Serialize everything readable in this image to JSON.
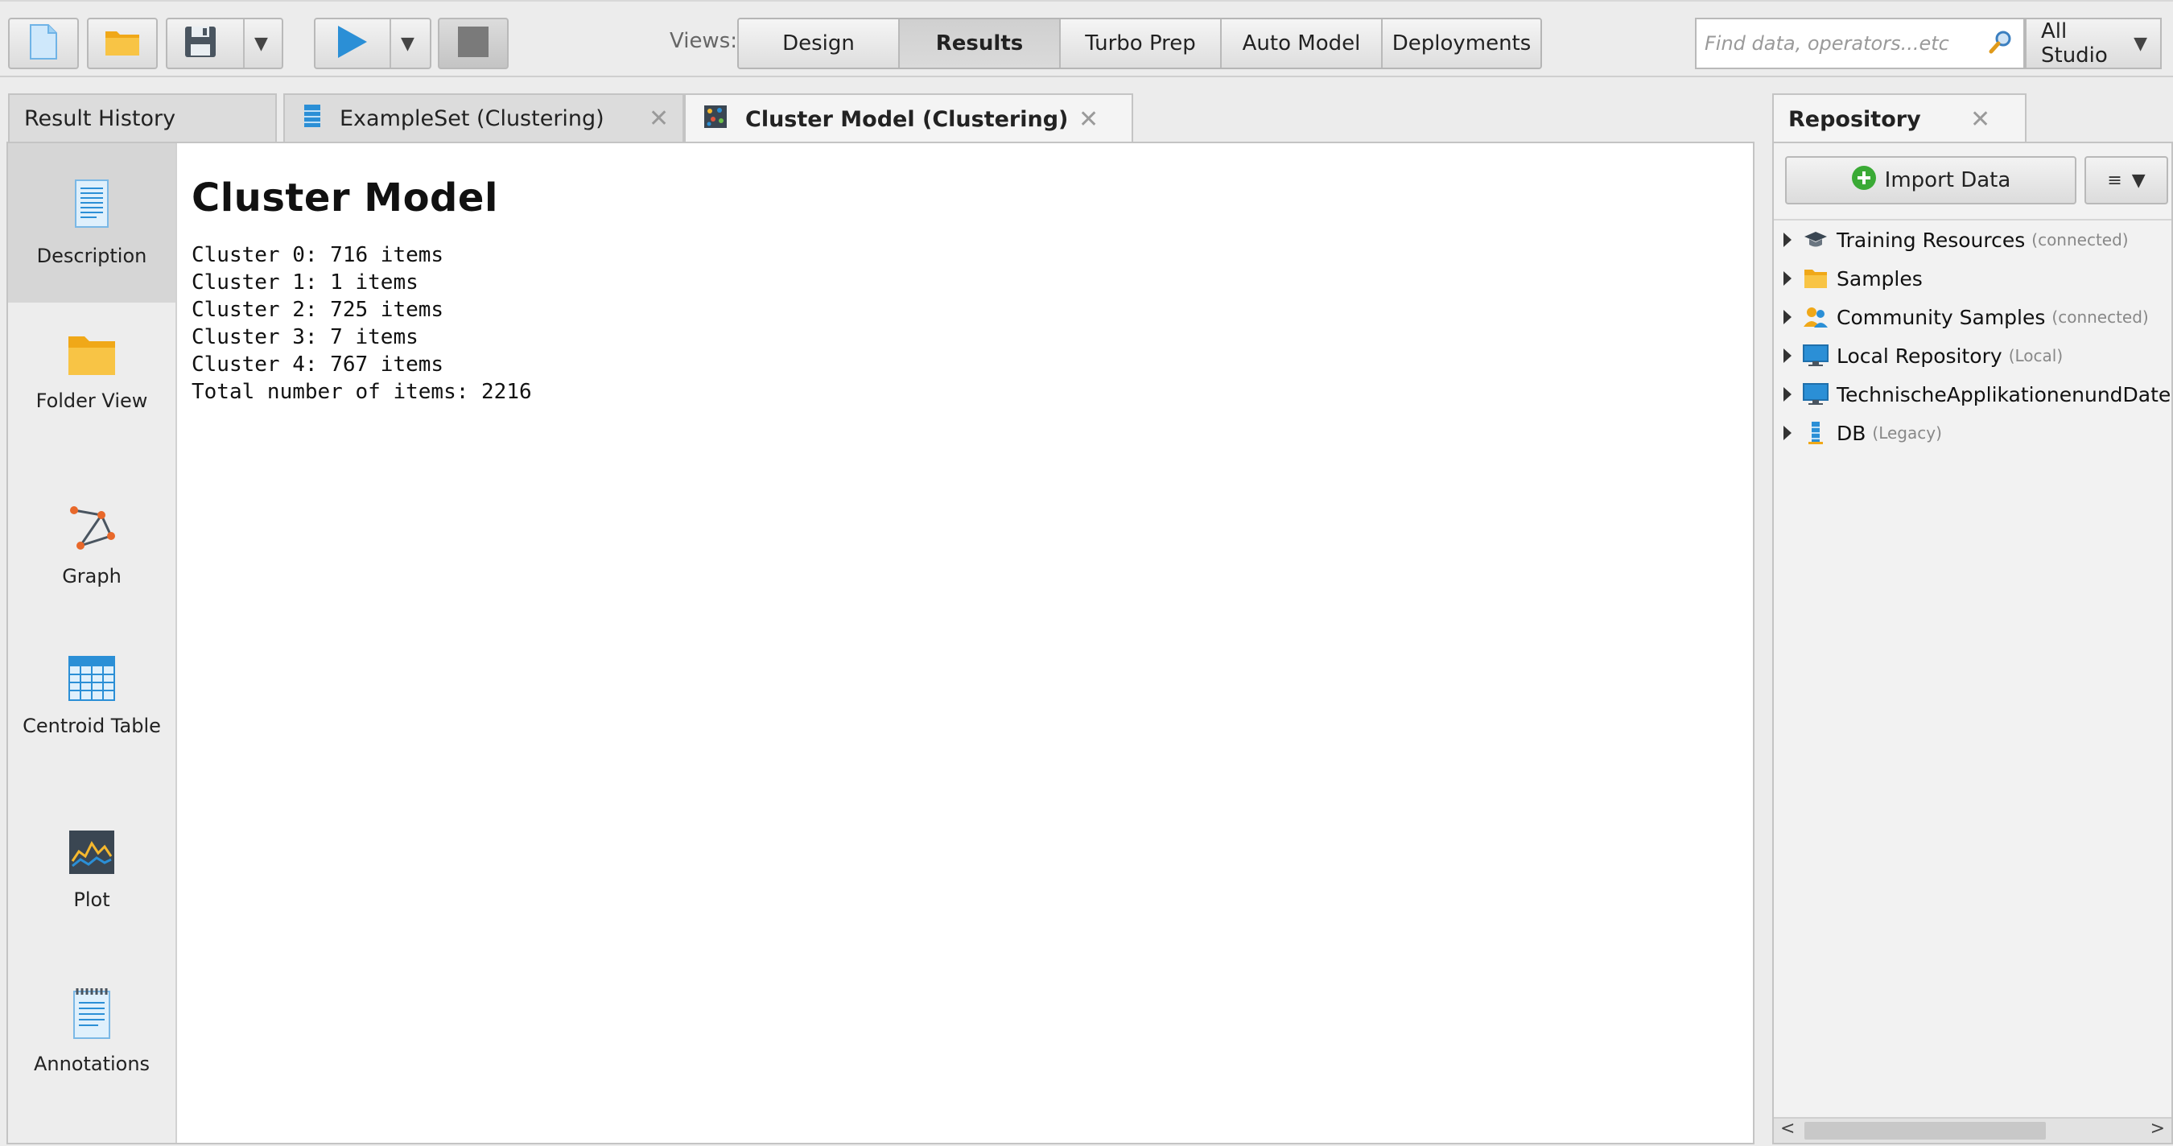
{
  "toolbar": {
    "new_icon": "new-process-icon",
    "open_icon": "folder-icon",
    "save_icon": "save-icon",
    "run_icon": "play-icon",
    "stop_icon": "stop-icon"
  },
  "views": {
    "label": "Views:",
    "items": [
      "Design",
      "Results",
      "Turbo Prep",
      "Auto Model",
      "Deployments"
    ],
    "active": "Results"
  },
  "search": {
    "placeholder": "Find data, operators...etc",
    "scope": "All Studio"
  },
  "tabs": [
    {
      "label": "Result History"
    },
    {
      "label": "ExampleSet (Clustering)"
    },
    {
      "label": "Cluster Model (Clustering)",
      "active": true
    }
  ],
  "sidebar": {
    "items": [
      {
        "label": "Description",
        "active": true
      },
      {
        "label": "Folder View"
      },
      {
        "label": "Graph"
      },
      {
        "label": "Centroid Table"
      },
      {
        "label": "Plot"
      },
      {
        "label": "Annotations"
      }
    ]
  },
  "model": {
    "title": "Cluster Model",
    "lines": [
      "Cluster 0: 716 items",
      "Cluster 1: 1 items",
      "Cluster 2: 725 items",
      "Cluster 3: 7 items",
      "Cluster 4: 767 items",
      "Total number of items: 2216"
    ]
  },
  "repository": {
    "title": "Repository",
    "import_label": "Import Data",
    "menu_label": "≡",
    "items": [
      {
        "label": "Training Resources",
        "note": "(connected)"
      },
      {
        "label": "Samples",
        "note": ""
      },
      {
        "label": "Community Samples",
        "note": "(connected)"
      },
      {
        "label": "Local Repository",
        "note": "(Local)"
      },
      {
        "label": "TechnischeApplikationenundDatenma",
        "note": ""
      },
      {
        "label": "DB",
        "note": "(Legacy)"
      }
    ]
  },
  "colors": {
    "accent_blue": "#2b8fd6",
    "folder_yellow": "#f5b82e",
    "import_green": "#3aaa35"
  }
}
